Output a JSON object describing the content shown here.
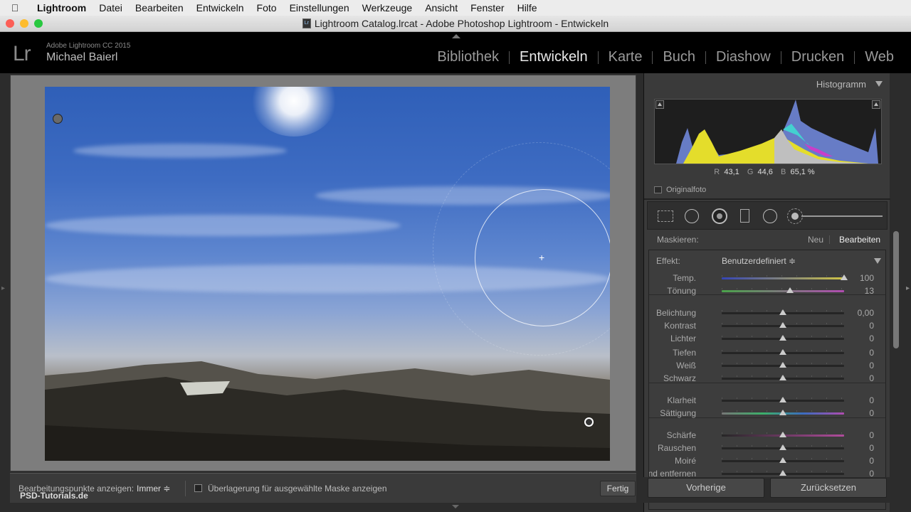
{
  "menubar": {
    "app": "Lightroom",
    "items": [
      "Datei",
      "Bearbeiten",
      "Entwickeln",
      "Foto",
      "Einstellungen",
      "Werkzeuge",
      "Ansicht",
      "Fenster",
      "Hilfe"
    ]
  },
  "window": {
    "title": "Lightroom Catalog.lrcat - Adobe Photoshop Lightroom - Entwickeln"
  },
  "identity": {
    "logo": "Lr",
    "product": "Adobe Lightroom CC 2015",
    "owner": "Michael Baierl"
  },
  "modules": [
    "Bibliothek",
    "Entwickeln",
    "Karte",
    "Buch",
    "Diashow",
    "Drucken",
    "Web"
  ],
  "toolbar": {
    "watermark": "PSD-Tutorials.de",
    "pins_label": "Bearbeitungspunkte anzeigen:",
    "pins_value": "Immer ≑",
    "overlay_label": "Überlagerung für ausgewählte Maske anzeigen",
    "done": "Fertig"
  },
  "histogram": {
    "title": "Histogramm",
    "rgb": {
      "r_label": "R",
      "r": "43,1",
      "g_label": "G",
      "g": "44,6",
      "b_label": "B",
      "b": "65,1 %"
    },
    "original_label": "Originalfoto"
  },
  "mask": {
    "label": "Maskieren:",
    "new": "Neu",
    "edit": "Bearbeiten"
  },
  "effect": {
    "label": "Effekt:",
    "value": "Benutzerdefiniert ≑"
  },
  "sliders": [
    {
      "label": "Temp.",
      "value": "100",
      "pos": 1.0,
      "track": "temp"
    },
    {
      "label": "Tönung",
      "value": "13",
      "pos": 0.56,
      "track": "tint"
    },
    {
      "label": "Belichtung",
      "value": "0,00",
      "pos": 0.5,
      "track": ""
    },
    {
      "label": "Kontrast",
      "value": "0",
      "pos": 0.5,
      "track": ""
    },
    {
      "label": "Lichter",
      "value": "0",
      "pos": 0.5,
      "track": ""
    },
    {
      "label": "Tiefen",
      "value": "0",
      "pos": 0.5,
      "track": ""
    },
    {
      "label": "Weiß",
      "value": "0",
      "pos": 0.5,
      "track": ""
    },
    {
      "label": "Schwarz",
      "value": "0",
      "pos": 0.5,
      "track": ""
    },
    {
      "label": "Klarheit",
      "value": "0",
      "pos": 0.5,
      "track": ""
    },
    {
      "label": "Sättigung",
      "value": "0",
      "pos": 0.5,
      "track": "sat"
    },
    {
      "label": "Schärfe",
      "value": "0",
      "pos": 0.5,
      "track": "sharp"
    },
    {
      "label": "Rauschen",
      "value": "0",
      "pos": 0.5,
      "track": ""
    },
    {
      "label": "Moiré",
      "value": "0",
      "pos": 0.5,
      "track": ""
    },
    {
      "label": "Rand entfernen",
      "value": "0",
      "pos": 0.5,
      "track": ""
    }
  ],
  "buttons": {
    "previous": "Vorherige",
    "reset": "Zurücksetzen"
  }
}
